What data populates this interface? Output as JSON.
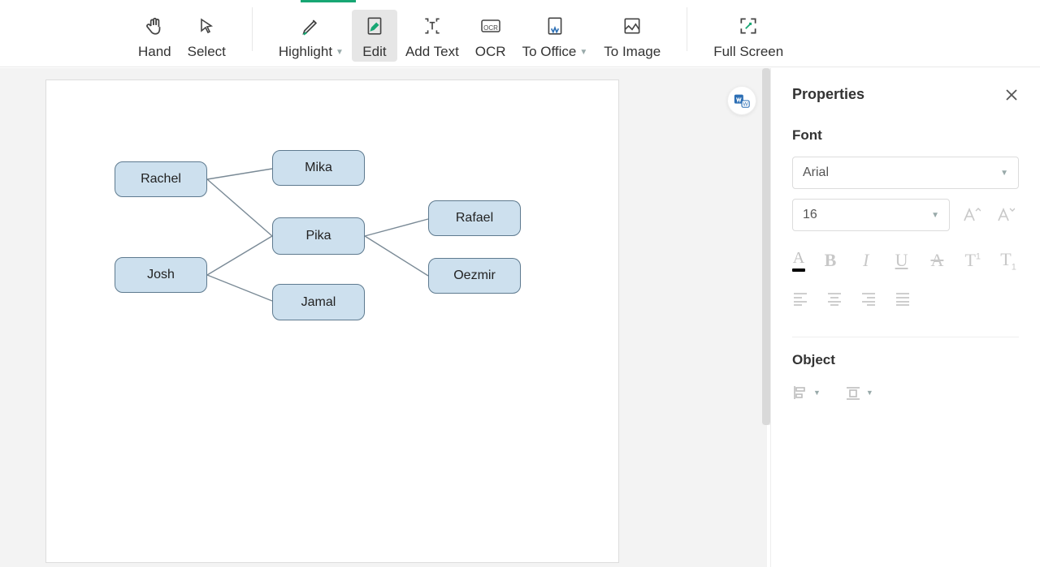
{
  "toolbar": {
    "hand": "Hand",
    "select": "Select",
    "highlight": "Highlight",
    "edit": "Edit",
    "add_text": "Add Text",
    "ocr": "OCR",
    "to_office": "To Office",
    "to_image": "To Image",
    "full_screen": "Full Screen"
  },
  "diagram": {
    "nodes": {
      "rachel": "Rachel",
      "josh": "Josh",
      "mika": "Mika",
      "pika": "Pika",
      "jamal": "Jamal",
      "rafael": "Rafael",
      "oezmir": "Oezmir"
    }
  },
  "panel": {
    "title": "Properties",
    "font_section": "Font",
    "font_family": "Arial",
    "font_size": "16",
    "object_section": "Object"
  }
}
